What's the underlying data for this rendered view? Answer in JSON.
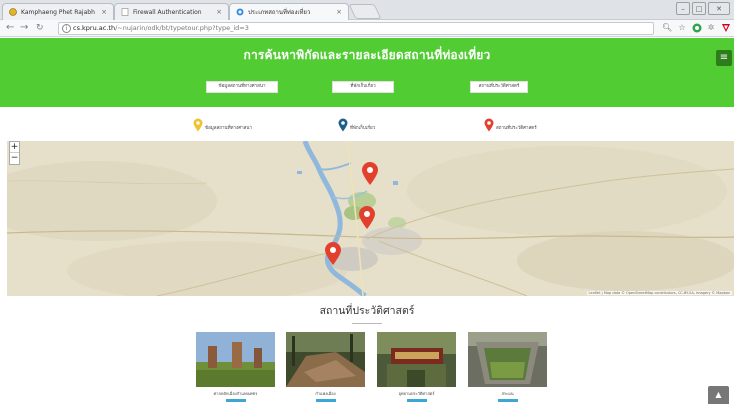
{
  "browser": {
    "tabs": [
      {
        "label": "Kamphaeng Phet Rajabh",
        "active": false
      },
      {
        "label": "Firewall Authentication",
        "active": false
      },
      {
        "label": "ประเภทสถานที่ท่องเที่ยว",
        "active": true
      }
    ],
    "url_host": "cs.kpru.ac.th",
    "url_path": "/~nujarin/odk/bt/typetour.php?type_id=3",
    "info_icon": "info-icon",
    "accent_color": "#52cc33"
  },
  "header": {
    "title": "การค้นหาพิกัดและรายละเอียดสถานที่ท่องเที่ยว",
    "buttons": [
      {
        "label": "ข้อมูลสถานที่ทางศาสนา"
      },
      {
        "label": "ที่พักเก็บเกี่ยว"
      },
      {
        "label": "สถานที่ประวัติศาสตร์"
      }
    ],
    "menu_icon": "hamburger-icon"
  },
  "legend": [
    {
      "label": "ข้อมูลสถานที่ทางศาสนา",
      "color": "#f2c12e"
    },
    {
      "label": "ที่พักเก็บเกี่ยว",
      "color": "#1d5f8a"
    },
    {
      "label": "สถานที่ประวัติศาสตร์",
      "color": "#e2402c"
    }
  ],
  "map": {
    "zoom_in": "+",
    "zoom_out": "−",
    "attribution": "Leaflet | Map data © OpenStreetMap contributors, CC-BY-SA, Imagery © Mapbox"
  },
  "section": {
    "title": "สถานที่ประวัติศาสตร์",
    "cards": [
      {
        "label": "ศาลหลักเมืองกำแพงเพชร"
      },
      {
        "label": "กำแพงเมือง"
      },
      {
        "label": "อุทยานประวัติศาสตร์"
      },
      {
        "label": "สระมน"
      }
    ]
  },
  "scroll_top": "▲"
}
